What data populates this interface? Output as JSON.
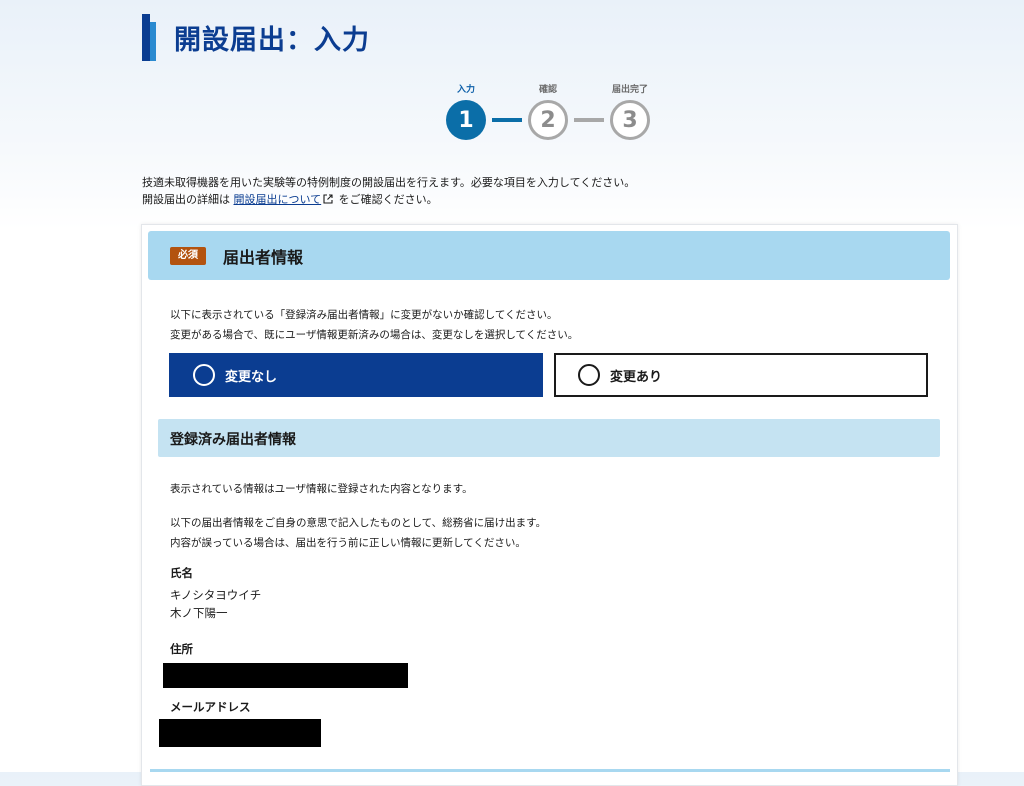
{
  "page": {
    "title": "開設届出：入力"
  },
  "stepper": {
    "steps": [
      {
        "label": "入力",
        "number": "1",
        "state": "active"
      },
      {
        "label": "確認",
        "number": "2",
        "state": "inactive"
      },
      {
        "label": "届出完了",
        "number": "3",
        "state": "inactive"
      }
    ]
  },
  "intro": {
    "line1": "技適未取得機器を用いた実験等の特例制度の開設届出を行えます。必要な項目を入力してください。",
    "line2_prefix": "開設届出の詳細は",
    "line2_link": "開設届出について",
    "line2_suffix": "をご確認ください。"
  },
  "section": {
    "badge": "必須",
    "title": "届出者情報",
    "instructions": [
      "以下に表示されている「登録済み届出者情報」に変更がないか確認してください。",
      "変更がある場合で、既にユーザ情報更新済みの場合は、変更なしを選択してください。"
    ],
    "options": [
      {
        "label": "変更なし",
        "selected": true
      },
      {
        "label": "変更あり",
        "selected": false
      }
    ]
  },
  "registered": {
    "title": "登録済み届出者情報",
    "text1": "表示されている情報はユーザ情報に登録された内容となります。",
    "text2": "以下の届出者情報をご自身の意思で記入したものとして、総務省に届け出ます。",
    "text3": "内容が誤っている場合は、届出を行う前に正しい情報に更新してください。",
    "name_label": "氏名",
    "name_kana": "キノシタヨウイチ",
    "name_kanji": "木ノ下陽一",
    "address_label": "住所",
    "email_label": "メールアドレス"
  },
  "colors": {
    "primary": "#0b3d91",
    "step_active": "#0b6ea8",
    "step_inactive": "#a8a8a8",
    "section_header": "#a8d8f0",
    "sub_header": "#c5e3f2",
    "required_badge": "#b3530f",
    "redaction": "#000000"
  }
}
